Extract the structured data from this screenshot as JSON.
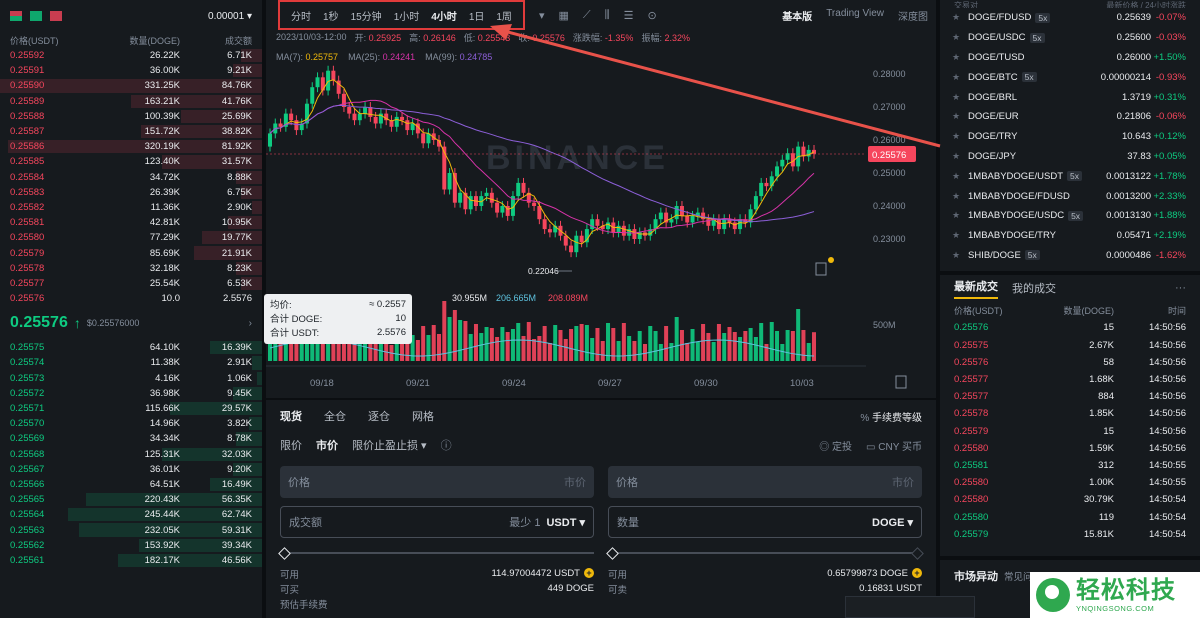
{
  "orderbook": {
    "precision": "0.00001",
    "headers": [
      "价格(USDT)",
      "数量(DOGE)",
      "成交额"
    ],
    "asks": [
      {
        "price": "0.25592",
        "qty": "26.22K",
        "total": "6.71K",
        "depth": 0.08
      },
      {
        "price": "0.25591",
        "qty": "36.00K",
        "total": "9.21K",
        "depth": 0.11
      },
      {
        "price": "0.25590",
        "qty": "331.25K",
        "total": "84.76K",
        "depth": 1.0
      },
      {
        "price": "0.25589",
        "qty": "163.21K",
        "total": "41.76K",
        "depth": 0.5
      },
      {
        "price": "0.25588",
        "qty": "100.39K",
        "total": "25.69K",
        "depth": 0.31
      },
      {
        "price": "0.25587",
        "qty": "151.72K",
        "total": "38.82K",
        "depth": 0.46
      },
      {
        "price": "0.25586",
        "qty": "320.19K",
        "total": "81.92K",
        "depth": 0.97
      },
      {
        "price": "0.25585",
        "qty": "123.40K",
        "total": "31.57K",
        "depth": 0.38
      },
      {
        "price": "0.25584",
        "qty": "34.72K",
        "total": "8.88K",
        "depth": 0.1
      },
      {
        "price": "0.25583",
        "qty": "26.39K",
        "total": "6.75K",
        "depth": 0.08
      },
      {
        "price": "0.25582",
        "qty": "11.36K",
        "total": "2.90K",
        "depth": 0.04
      },
      {
        "price": "0.25581",
        "qty": "42.81K",
        "total": "10.95K",
        "depth": 0.13
      },
      {
        "price": "0.25580",
        "qty": "77.29K",
        "total": "19.77K",
        "depth": 0.23
      },
      {
        "price": "0.25579",
        "qty": "85.69K",
        "total": "21.91K",
        "depth": 0.26
      },
      {
        "price": "0.25578",
        "qty": "32.18K",
        "total": "8.23K",
        "depth": 0.1
      },
      {
        "price": "0.25577",
        "qty": "25.54K",
        "total": "6.53K",
        "depth": 0.08
      },
      {
        "price": "0.25576",
        "qty": "10.0",
        "total": "2.5576",
        "depth": 0.0
      }
    ],
    "last_price": "0.25576",
    "last_arrow": "↑",
    "last_fiat": "$0.25576000",
    "bids": [
      {
        "price": "0.25575",
        "qty": "64.10K",
        "total": "16.39K",
        "depth": 0.2
      },
      {
        "price": "0.25574",
        "qty": "11.38K",
        "total": "2.91K",
        "depth": 0.04
      },
      {
        "price": "0.25573",
        "qty": "4.16K",
        "total": "1.06K",
        "depth": 0.02
      },
      {
        "price": "0.25572",
        "qty": "36.98K",
        "total": "9.45K",
        "depth": 0.11
      },
      {
        "price": "0.25571",
        "qty": "115.66K",
        "total": "29.57K",
        "depth": 0.35
      },
      {
        "price": "0.25570",
        "qty": "14.96K",
        "total": "3.82K",
        "depth": 0.05
      },
      {
        "price": "0.25569",
        "qty": "34.34K",
        "total": "8.78K",
        "depth": 0.1
      },
      {
        "price": "0.25568",
        "qty": "125.31K",
        "total": "32.03K",
        "depth": 0.38
      },
      {
        "price": "0.25567",
        "qty": "36.01K",
        "total": "9.20K",
        "depth": 0.11
      },
      {
        "price": "0.25566",
        "qty": "64.51K",
        "total": "16.49K",
        "depth": 0.2
      },
      {
        "price": "0.25565",
        "qty": "220.43K",
        "total": "56.35K",
        "depth": 0.67
      },
      {
        "price": "0.25564",
        "qty": "245.44K",
        "total": "62.74K",
        "depth": 0.74
      },
      {
        "price": "0.25563",
        "qty": "232.05K",
        "total": "59.31K",
        "depth": 0.7
      },
      {
        "price": "0.25562",
        "qty": "153.92K",
        "total": "39.34K",
        "depth": 0.47
      },
      {
        "price": "0.25561",
        "qty": "182.17K",
        "total": "46.56K",
        "depth": 0.55
      }
    ]
  },
  "chart": {
    "timeframes": [
      "分时",
      "1秒",
      "15分钟",
      "1小时",
      "4小时",
      "1日",
      "1周"
    ],
    "active_timeframe": "4小时",
    "views": [
      "基本版",
      "Trading View",
      "深度图"
    ],
    "active_view": "基本版",
    "ohlc": {
      "date": "2023/10/03-12:00",
      "open_label": "开:",
      "open": "0.25925",
      "high_label": "高:",
      "high": "0.26146",
      "low_label": "低:",
      "low": "0.25543",
      "close_label": "收:",
      "close": "0.25576",
      "change_label": "涨跌幅:",
      "change": "-1.35%",
      "amp_label": "振幅:",
      "amp": "2.32%"
    },
    "ma": {
      "ma7_label": "MA(7):",
      "ma7": "0.25757",
      "ma25_label": "MA(25):",
      "ma25": "0.24241",
      "ma99_label": "MA(99):",
      "ma99": "0.24785"
    },
    "vol": {
      "label": "Vol(USDT)",
      "v1": "30.955M",
      "v2": "206.665M",
      "v3": "208.089M"
    },
    "price_labels": [
      "0.28000",
      "0.27000",
      "0.26000",
      "0.25000",
      "0.24000",
      "0.23000"
    ],
    "current_price_tag": "0.25576",
    "low_marker": "0.22046",
    "vol_axis_label": "500M",
    "dates": [
      "09/18",
      "09/21",
      "09/24",
      "09/27",
      "09/30",
      "10/03"
    ],
    "watermark": "BINANCE",
    "tooltip": {
      "avg_label": "均价:",
      "avg": "≈ 0.2557",
      "sum_doge_label": "合计 DOGE:",
      "sum_doge": "10",
      "sum_usdt_label": "合计 USDT:",
      "sum_usdt": "2.5576"
    },
    "colors": {
      "up": "#0ecb81",
      "down": "#f6465d",
      "ma7": "#f0b90b",
      "ma25": "#d633a8",
      "ma99": "#8c5fd8"
    }
  },
  "order_form": {
    "tabs": [
      "现货",
      "全仓",
      "逐仓",
      "网格"
    ],
    "fee_label": "手续费等级",
    "sub_tabs": [
      "限价",
      "市价",
      "限价止盈止损 ▾"
    ],
    "right_links": [
      "定投",
      "CNY 买币"
    ],
    "buy": {
      "price_label": "价格",
      "price_hint": "市价",
      "amount_label": "成交额",
      "min_label": "最少 1",
      "unit": "USDT ▾",
      "avail_label": "可用",
      "avail": "114.97004472 USDT",
      "can_label": "可买",
      "can": "449 DOGE",
      "fee_label": "预估手续费"
    },
    "sell": {
      "price_label": "价格",
      "price_hint": "市价",
      "qty_label": "数量",
      "unit": "DOGE ▾",
      "avail_label": "可用",
      "avail": "0.65799873 DOGE",
      "can_label": "可卖",
      "can": "0.16831 USDT"
    }
  },
  "markets": {
    "header_left": "交易对",
    "header_right": "最新价格 / 24小时涨跌",
    "rows": [
      {
        "pair": "DOGE/FDUSD",
        "lev": "5x",
        "price": "0.25639",
        "change": "-0.07%",
        "dir": "neg"
      },
      {
        "pair": "DOGE/USDC",
        "lev": "5x",
        "price": "0.25600",
        "change": "-0.03%",
        "dir": "neg"
      },
      {
        "pair": "DOGE/TUSD",
        "lev": "",
        "price": "0.26000",
        "change": "+1.50%",
        "dir": "pos"
      },
      {
        "pair": "DOGE/BTC",
        "lev": "5x",
        "price": "0.00000214",
        "change": "-0.93%",
        "dir": "neg"
      },
      {
        "pair": "DOGE/BRL",
        "lev": "",
        "price": "1.3719",
        "change": "+0.31%",
        "dir": "pos"
      },
      {
        "pair": "DOGE/EUR",
        "lev": "",
        "price": "0.21806",
        "change": "-0.06%",
        "dir": "neg"
      },
      {
        "pair": "DOGE/TRY",
        "lev": "",
        "price": "10.643",
        "change": "+0.12%",
        "dir": "pos"
      },
      {
        "pair": "DOGE/JPY",
        "lev": "",
        "price": "37.83",
        "change": "+0.05%",
        "dir": "pos"
      },
      {
        "pair": "1MBABYDOGE/USDT",
        "lev": "5x",
        "price": "0.0013122",
        "change": "+1.78%",
        "dir": "pos"
      },
      {
        "pair": "1MBABYDOGE/FDUSD",
        "lev": "",
        "price": "0.0013200",
        "change": "+2.33%",
        "dir": "pos"
      },
      {
        "pair": "1MBABYDOGE/USDC",
        "lev": "5x",
        "price": "0.0013130",
        "change": "+1.88%",
        "dir": "pos"
      },
      {
        "pair": "1MBABYDOGE/TRY",
        "lev": "",
        "price": "0.05471",
        "change": "+2.19%",
        "dir": "pos"
      },
      {
        "pair": "SHIB/DOGE",
        "lev": "5x",
        "price": "0.0000486",
        "change": "-1.62%",
        "dir": "neg"
      }
    ]
  },
  "trades": {
    "tab_latest": "最新成交",
    "tab_mine": "我的成交",
    "more": "···",
    "headers": [
      "价格(USDT)",
      "数量(DOGE)",
      "时间"
    ],
    "rows": [
      {
        "p": "0.25576",
        "q": "15",
        "t": "14:50:56",
        "d": "pos"
      },
      {
        "p": "0.25575",
        "q": "2.67K",
        "t": "14:50:56",
        "d": "neg"
      },
      {
        "p": "0.25576",
        "q": "58",
        "t": "14:50:56",
        "d": "neg"
      },
      {
        "p": "0.25577",
        "q": "1.68K",
        "t": "14:50:56",
        "d": "neg"
      },
      {
        "p": "0.25577",
        "q": "884",
        "t": "14:50:56",
        "d": "neg"
      },
      {
        "p": "0.25578",
        "q": "1.85K",
        "t": "14:50:56",
        "d": "neg"
      },
      {
        "p": "0.25579",
        "q": "15",
        "t": "14:50:56",
        "d": "neg"
      },
      {
        "p": "0.25580",
        "q": "1.59K",
        "t": "14:50:56",
        "d": "neg"
      },
      {
        "p": "0.25581",
        "q": "312",
        "t": "14:50:55",
        "d": "pos"
      },
      {
        "p": "0.25580",
        "q": "1.00K",
        "t": "14:50:55",
        "d": "neg"
      },
      {
        "p": "0.25580",
        "q": "30.79K",
        "t": "14:50:54",
        "d": "neg"
      },
      {
        "p": "0.25580",
        "q": "119",
        "t": "14:50:54",
        "d": "pos"
      },
      {
        "p": "0.25579",
        "q": "15.81K",
        "t": "14:50:54",
        "d": "pos"
      }
    ]
  },
  "market_moves": {
    "title": "市场异动",
    "sub": "常见问题"
  },
  "watermark_logo": {
    "cn": "轻松科技",
    "url": "YNQINGSONG.COM"
  }
}
